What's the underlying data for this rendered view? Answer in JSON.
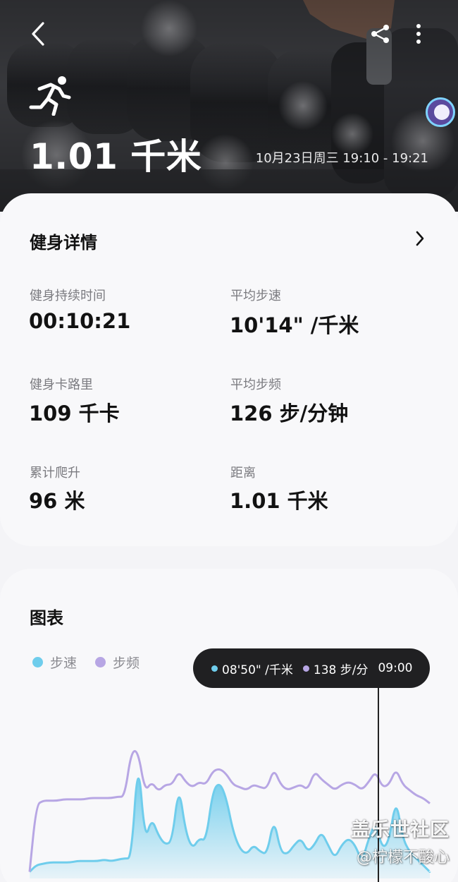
{
  "header": {
    "distance": "1.01 千米",
    "time_range": "10月23日周三 19:10 - 19:21",
    "icons": {
      "back": "chevron-left-icon",
      "share": "share-icon",
      "more": "more-vertical-icon",
      "activity": "running-icon",
      "device": "watch-badge-icon"
    }
  },
  "details": {
    "title": "健身详情",
    "metrics": [
      {
        "label": "健身持续时间",
        "value": "00:10:21"
      },
      {
        "label": "平均步速",
        "value": "10'14\" /千米"
      },
      {
        "label": "健身卡路里",
        "value": "109 千卡"
      },
      {
        "label": "平均步频",
        "value": "126 步/分钟"
      },
      {
        "label": "累计爬升",
        "value": "96 米"
      },
      {
        "label": "距离",
        "value": "1.01 千米"
      }
    ]
  },
  "chart": {
    "title": "图表",
    "legend": [
      {
        "label": "步速",
        "color": "#6fcdec"
      },
      {
        "label": "步频",
        "color": "#b7a6e4"
      }
    ],
    "tooltip": {
      "pace": "08'50\" /千米",
      "cadence": "138 步/分",
      "time": "09:00"
    }
  },
  "chart_data": {
    "type": "area",
    "series": [
      {
        "name": "步速",
        "color": "#6fcdec",
        "values": [
          0.05,
          0.1,
          0.11,
          0.12,
          0.12,
          0.12,
          0.12,
          0.13,
          0.13,
          0.13,
          0.13,
          0.14,
          0.13,
          0.14,
          0.15,
          0.15,
          0.92,
          0.28,
          0.45,
          0.32,
          0.25,
          0.28,
          0.7,
          0.35,
          0.22,
          0.3,
          0.28,
          0.65,
          0.72,
          0.6,
          0.35,
          0.22,
          0.18,
          0.25,
          0.2,
          0.18,
          0.45,
          0.2,
          0.18,
          0.25,
          0.3,
          0.2,
          0.25,
          0.35,
          0.25,
          0.15,
          0.25,
          0.3,
          0.25,
          0.12,
          0.3,
          0.42,
          0.22,
          0.28,
          0.6,
          0.3,
          0.2,
          0.15,
          0.1,
          0.05
        ]
      },
      {
        "name": "步频",
        "color": "#b7a6e4",
        "values": [
          0.05,
          0.55,
          0.58,
          0.58,
          0.58,
          0.59,
          0.59,
          0.59,
          0.59,
          0.6,
          0.6,
          0.6,
          0.6,
          0.61,
          0.61,
          0.95,
          0.95,
          0.65,
          0.72,
          0.65,
          0.7,
          0.7,
          0.8,
          0.72,
          0.68,
          0.72,
          0.7,
          0.8,
          0.82,
          0.78,
          0.7,
          0.68,
          0.66,
          0.7,
          0.68,
          0.67,
          0.82,
          0.7,
          0.66,
          0.68,
          0.7,
          0.66,
          0.8,
          0.74,
          0.7,
          0.66,
          0.7,
          0.72,
          0.7,
          0.66,
          0.72,
          0.8,
          0.68,
          0.7,
          0.82,
          0.7,
          0.66,
          0.62,
          0.6,
          0.56
        ]
      }
    ]
  }
}
